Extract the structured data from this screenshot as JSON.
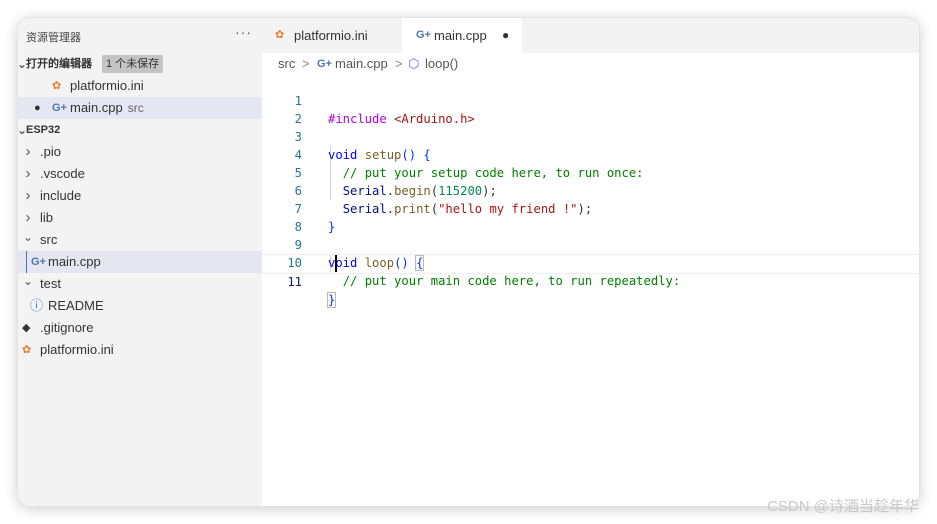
{
  "explorer": {
    "title": "资源管理器",
    "more": "···",
    "open_editors": {
      "label": "打开的编辑器",
      "badge": "1 个未保存",
      "items": [
        {
          "name": "platformio.ini",
          "desc": "",
          "icon": "platformio-icon"
        },
        {
          "name": "main.cpp",
          "desc": "src",
          "icon": "cpp-icon",
          "modified_dot": "●"
        }
      ]
    },
    "workspace": {
      "label": "ESP32",
      "tree": [
        {
          "name": ".pio",
          "chevron": "›"
        },
        {
          "name": ".vscode",
          "chevron": "›"
        },
        {
          "name": "include",
          "chevron": "›"
        },
        {
          "name": "lib",
          "chevron": "›"
        },
        {
          "name": "src",
          "chevron": "⌄"
        },
        {
          "name": "main.cpp",
          "icon": "cpp-icon"
        },
        {
          "name": "test",
          "chevron": "⌄"
        },
        {
          "name": "README",
          "icon": "info-icon"
        },
        {
          "name": ".gitignore",
          "icon": "git-icon"
        },
        {
          "name": "platformio.ini",
          "icon": "platformio-icon"
        }
      ]
    }
  },
  "tabs": [
    {
      "label": "platformio.ini",
      "icon": "platformio-icon"
    },
    {
      "label": "main.cpp",
      "icon": "cpp-icon",
      "modified_dot": "●"
    }
  ],
  "breadcrumb": {
    "folder": "src",
    "file": "main.cpp",
    "symbol": "loop()",
    "separator": ">"
  },
  "code": {
    "line_numbers": [
      "1",
      "2",
      "3",
      "4",
      "5",
      "6",
      "7",
      "8",
      "9",
      "10",
      "11"
    ],
    "line1": {
      "pp": "#include",
      "header": "<Arduino.h>"
    },
    "line3": {
      "kw": "void",
      "fn": "setup",
      "punct": "() {"
    },
    "line4": {
      "comment": "// put your setup code here, to run once:"
    },
    "line5": {
      "obj": "Serial",
      "dot": ".",
      "fn": "begin",
      "open": "(",
      "num": "115200",
      "close": ");"
    },
    "line6": {
      "obj": "Serial",
      "dot": ".",
      "fn": "print",
      "open": "(",
      "str": "\"hello my friend !\"",
      "close": ");"
    },
    "line7": {
      "brace": "}"
    },
    "line9": {
      "kw": "void",
      "fn": "loop",
      "punct": "() ",
      "brace": "{"
    },
    "line10": {
      "comment": "// put your main code here, to run repeatedly:"
    },
    "line11": {
      "brace": "}"
    }
  },
  "watermark": "CSDN @诗酒当趁年华",
  "colors": {
    "keyword": "#0000ff",
    "preprocessor": "#af00db",
    "string": "#a31515",
    "function": "#795e26",
    "number": "#098658",
    "comment": "#008000",
    "line_number": "#237893",
    "sidebar_bg": "#f3f3f3",
    "selection": "#e4e6f1"
  }
}
